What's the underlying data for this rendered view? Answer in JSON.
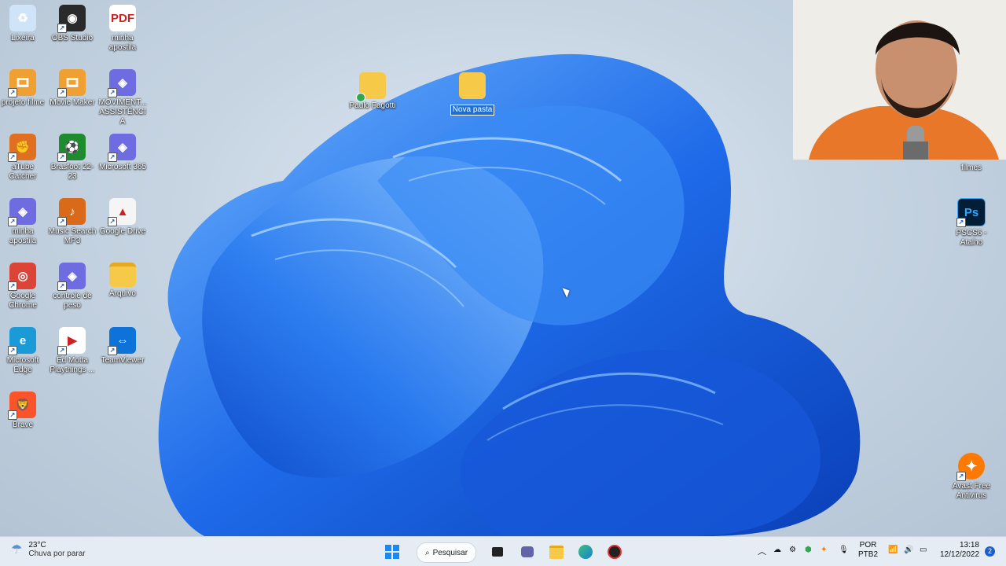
{
  "desktop": {
    "icons_left": [
      {
        "label": "Lixeira",
        "icon": "recycle-bin-icon",
        "color": "#cfe4f7",
        "glyph": "♻"
      },
      {
        "label": "OBS Studio",
        "icon": "obs-icon",
        "color": "#2a2a2a",
        "glyph": "◉"
      },
      {
        "label": "minha apostila",
        "icon": "pdf-icon",
        "color": "#ffffff",
        "glyph": "PDF"
      },
      {
        "label": "projeto filme",
        "icon": "movie-maker-icon",
        "color": "#f0a030",
        "glyph": "🎞"
      },
      {
        "label": "Movie Maker",
        "icon": "movie-maker-icon",
        "color": "#f0a030",
        "glyph": "🎞"
      },
      {
        "label": "MOVIMENT... ASSISTÊNCIA",
        "icon": "microsoft365-icon",
        "color": "#6e6ce0",
        "glyph": "◈"
      },
      {
        "label": "aTube Catcher",
        "icon": "atube-catcher-icon",
        "color": "#e07020",
        "glyph": "✊"
      },
      {
        "label": "Brasfoot 22-23",
        "icon": "brasfoot-icon",
        "color": "#1f8a2e",
        "glyph": "⚽"
      },
      {
        "label": "Microsoft 365",
        "icon": "microsoft365-icon",
        "color": "#6e6ce0",
        "glyph": "◈"
      },
      {
        "label": "minha apostila",
        "icon": "microsoft365-icon",
        "color": "#6e6ce0",
        "glyph": "◈"
      },
      {
        "label": "Music Search MP3",
        "icon": "music-search-icon",
        "color": "#d86a1a",
        "glyph": "♪"
      },
      {
        "label": "Google Drive",
        "icon": "google-drive-icon",
        "color": "#f5f5f5",
        "glyph": "▲"
      },
      {
        "label": "Google Chrome",
        "icon": "chrome-icon",
        "color": "#db4437",
        "glyph": "◎"
      },
      {
        "label": "controle de peso",
        "icon": "microsoft365-icon",
        "color": "#6e6ce0",
        "glyph": "◈"
      },
      {
        "label": "Arquivo",
        "icon": "folder-icon",
        "color": "#f7c948",
        "glyph": ""
      },
      {
        "label": "Microsoft Edge",
        "icon": "edge-icon",
        "color": "#1a9ad6",
        "glyph": "e"
      },
      {
        "label": "Ed Motta Playthings ...",
        "icon": "media-file-icon",
        "color": "#ffffff",
        "glyph": "▶"
      },
      {
        "label": "TeamViewer",
        "icon": "teamviewer-icon",
        "color": "#0e73d8",
        "glyph": "⇔"
      },
      {
        "label": "Brave",
        "icon": "brave-icon",
        "color": "#fb542b",
        "glyph": "🦁"
      }
    ],
    "icons_center": [
      {
        "label": "Paulo Fagotti",
        "icon": "folder-icon"
      },
      {
        "label": "Nova pasta",
        "icon": "folder-icon"
      }
    ],
    "icons_right": [
      {
        "label": "filmes",
        "icon": "folder-icon"
      },
      {
        "label": "PSCS6 - Atalho",
        "icon": "photoshop-icon",
        "glyph": "Ps"
      },
      {
        "label": "Avast Free Antivirus",
        "icon": "avast-icon"
      }
    ]
  },
  "taskbar": {
    "weather_temp": "23°C",
    "weather_desc": "Chuva por parar",
    "search_label": "Pesquisar",
    "lang_top": "POR",
    "lang_bottom": "PTB2",
    "time": "13:18",
    "date": "12/12/2022",
    "notification_count": "2"
  },
  "colors": {
    "selection": "#1f6fd1",
    "taskbar_bg": "#e6ecf3",
    "bloom_dark": "#0a3fb8",
    "bloom_light": "#58a8ff"
  }
}
